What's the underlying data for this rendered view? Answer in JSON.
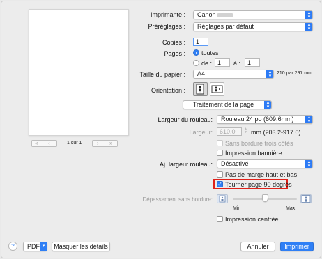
{
  "preview": {
    "page_indicator": "1 sur 1",
    "first": "«",
    "prev": "‹",
    "next": "›",
    "last": "»"
  },
  "printer": {
    "label": "Imprimante :",
    "value": "Canon"
  },
  "presets": {
    "label": "Préréglages :",
    "value": "Réglages par défaut"
  },
  "copies": {
    "label": "Copies :",
    "value": "1"
  },
  "pages": {
    "label": "Pages :",
    "all_label": "toutes",
    "from_label": "de :",
    "from_value": "1",
    "to_label": "à :",
    "to_value": "1"
  },
  "paper_size": {
    "label": "Taille du papier :",
    "value": "A4",
    "dimensions": "210 par 297 mm"
  },
  "orientation": {
    "label": "Orientation :"
  },
  "panel": {
    "value": "Traitement de la page"
  },
  "roll_width": {
    "label": "Largeur du rouleau:",
    "value": "Rouleau 24 po (609,6mm)"
  },
  "width": {
    "label": "Largeur:",
    "value": "610.0",
    "unit": "mm (203.2-917.0)"
  },
  "options": {
    "borderless_three": "Sans bordure trois côtés",
    "banner": "Impression bannière",
    "roll_adjust_label": "Aj. largeur rouleau:",
    "roll_adjust_value": "Désactivé",
    "top_bottom_margin": "Pas de marge haut et bas",
    "rotate_90": "Tourner page 90 degrés",
    "overflow_label": "Dépassement sans bordure:",
    "slider_min": "Min",
    "slider_max": "Max",
    "slider_level": 0.5,
    "centered": "Impression centrée"
  },
  "footer": {
    "help": "?",
    "pdf": "PDF",
    "hide_details": "Masquer les détails",
    "cancel": "Annuler",
    "print": "Imprimer"
  },
  "colors": {
    "accent": "#2f7ff5",
    "highlight": "#e0221a"
  }
}
